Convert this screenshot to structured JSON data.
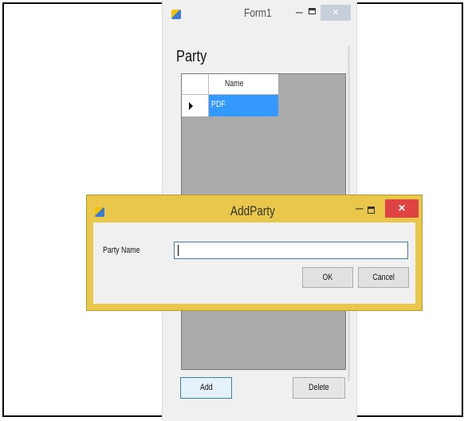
{
  "form1": {
    "title": "Form1",
    "minimize_glyph": "–",
    "close_glyph": "✕",
    "group_label": "Party",
    "grid": {
      "columns": [
        "Name"
      ],
      "rows": [
        {
          "selected": true,
          "cells": [
            "PDF"
          ]
        }
      ]
    },
    "add_label": "Add",
    "delete_label": "Delete"
  },
  "dialog": {
    "title": "AddParty",
    "minimize_glyph": "–",
    "close_glyph": "✕",
    "field_label": "Party Name",
    "field_value": "",
    "ok_label": "OK",
    "cancel_label": "Cancel"
  },
  "colors": {
    "dialog_titlebar": "#e8c74a",
    "selection": "#3399ff",
    "close_button": "#e04343",
    "grid_background": "#ababab"
  },
  "icons": [
    "app-icon",
    "minimize-icon",
    "maximize-icon",
    "close-icon",
    "row-selector-arrow-icon"
  ]
}
